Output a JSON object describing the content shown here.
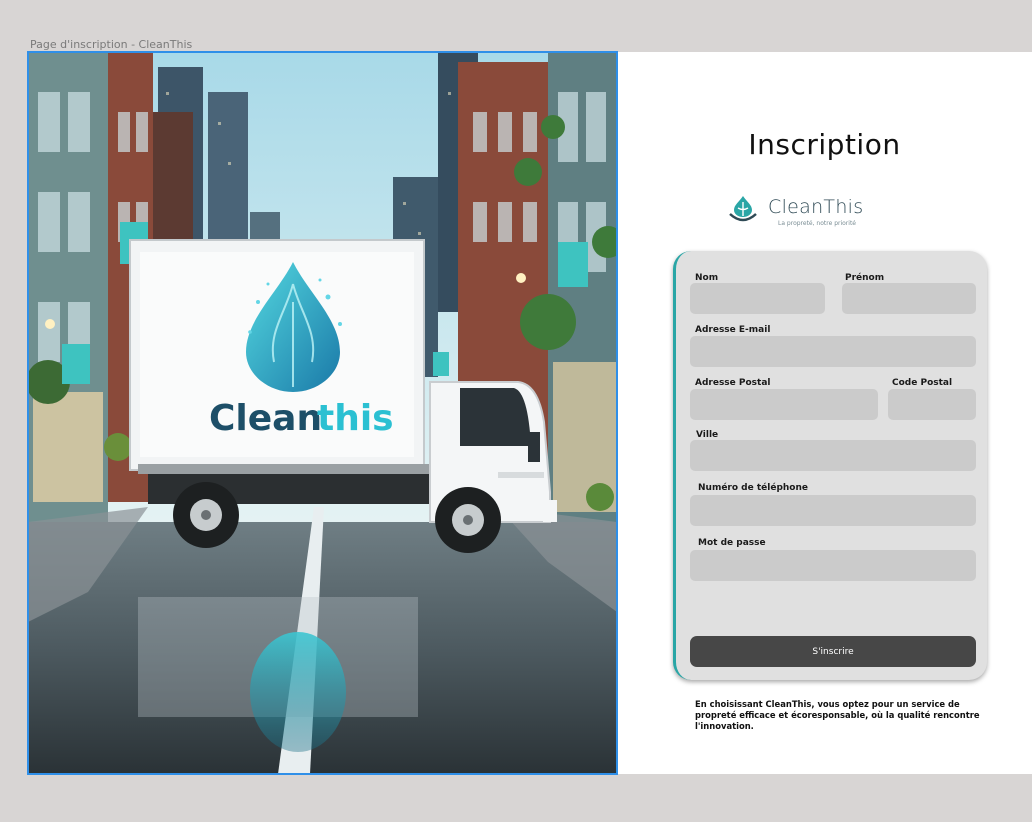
{
  "window": {
    "frame_label": "Page d'inscription - CleanThis"
  },
  "hero": {
    "truck_logo_text_a": "Clean",
    "truck_logo_text_b": "this"
  },
  "page": {
    "title": "Inscription"
  },
  "brand": {
    "name": "CleanThis",
    "tagline": "La propreté, notre priorité",
    "colors": {
      "teal": "#2aa6a6",
      "dark": "#2f4a55"
    }
  },
  "form": {
    "fields": {
      "nom": {
        "label": "Nom",
        "value": "",
        "placeholder": ""
      },
      "prenom": {
        "label": "Prénom",
        "value": "",
        "placeholder": ""
      },
      "email": {
        "label": "Adresse E-mail",
        "value": "",
        "placeholder": ""
      },
      "adresse": {
        "label": "Adresse Postal",
        "value": "",
        "placeholder": ""
      },
      "code_postal": {
        "label": "Code Postal",
        "value": "",
        "placeholder": ""
      },
      "ville": {
        "label": "Ville",
        "value": "",
        "placeholder": ""
      },
      "telephone": {
        "label": "Numéro de téléphone",
        "value": "",
        "placeholder": ""
      },
      "password": {
        "label": "Mot de passe",
        "value": "",
        "placeholder": ""
      }
    },
    "submit_label": "S'inscrire"
  },
  "footer": {
    "text": "En choisissant CleanThis, vous optez pour un service de propreté efficace et écoresponsable, où la qualité rencontre l'innovation."
  }
}
